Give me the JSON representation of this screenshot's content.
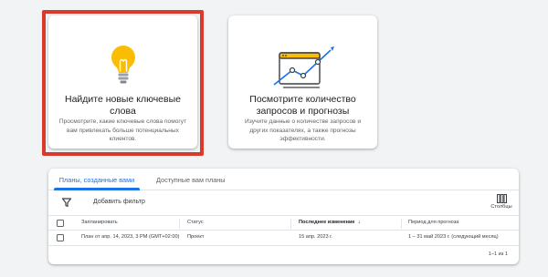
{
  "cards": [
    {
      "title": "Найдите новые ключевые слова",
      "description": "Просмотрите, какие ключевые слова помогут вам привлекать больше потенциальных клиентов.",
      "icon": "lightbulb-icon"
    },
    {
      "title": "Посмотрите количество запросов и прогнозы",
      "description": "Изучите данные о количестве запросов и других показателях, а также прогнозы эффективности.",
      "icon": "trend-chart-icon"
    }
  ],
  "tabs": {
    "plans_created": "Планы, созданные вами",
    "available_plans": "Доступные вам планы"
  },
  "toolbar": {
    "filter_icon": "filter-icon",
    "add_filter": "Добавить фильтр",
    "columns_label": "Столбцы",
    "columns_icon": "columns-icon"
  },
  "table": {
    "headers": {
      "plan": "Запланировать",
      "status": "Статус",
      "last_modified": "Последнее изменение",
      "forecast_period": "Период для прогноза"
    },
    "rows": [
      {
        "plan": "План от апр. 14, 2023, 3 PM (GMT+02:00)",
        "status": "Проект",
        "last_modified": "15 апр. 2023 г.",
        "forecast_period": "1 – 31 май 2023 г. (следующий месяц)"
      }
    ],
    "pagination": "1–1 из 1"
  },
  "colors": {
    "accent": "#1a73e8",
    "highlight": "#d93a2b",
    "bulb": "#fbbc04"
  }
}
